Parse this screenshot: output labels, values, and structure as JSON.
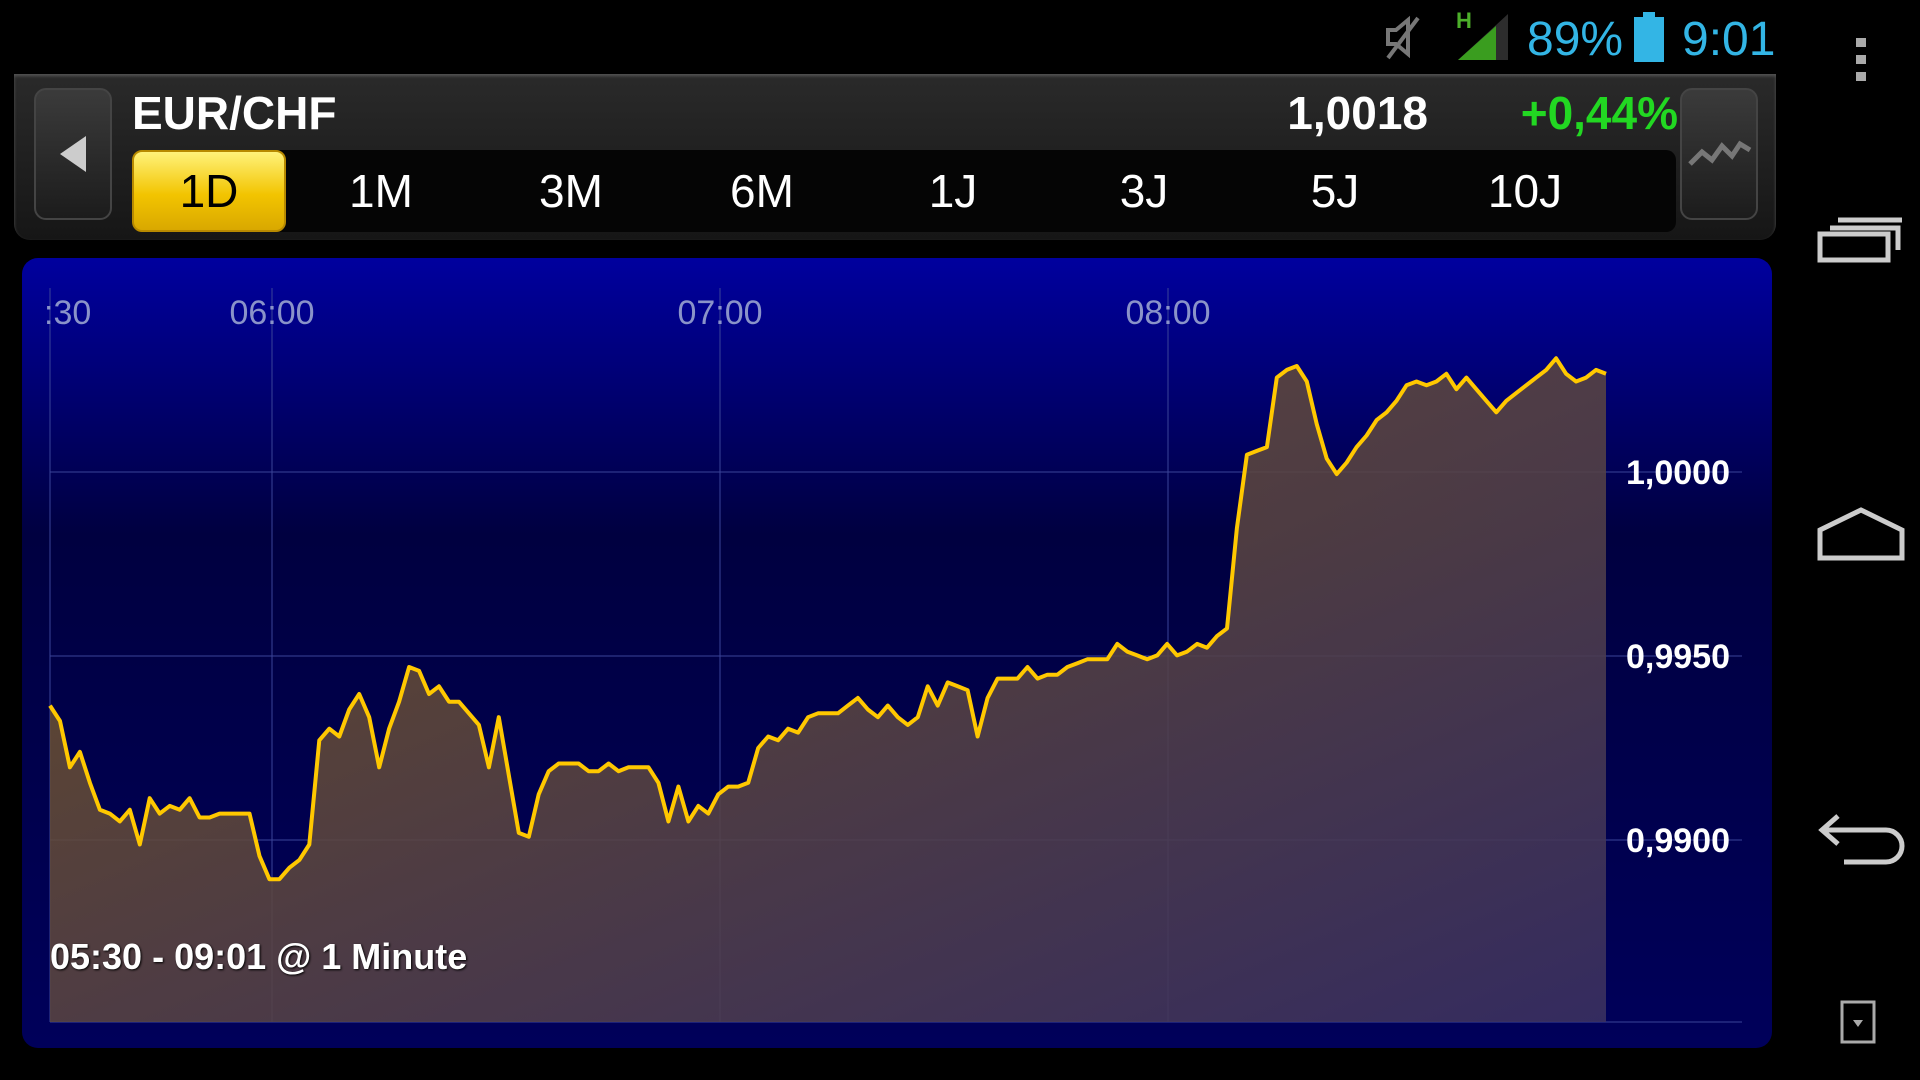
{
  "status_bar": {
    "battery_percent": "89%",
    "time": "9:01",
    "network_type": "H",
    "icons": [
      "mute-icon",
      "signal-icon",
      "battery-icon"
    ]
  },
  "header": {
    "pair": "EUR/CHF",
    "price": "1,0018",
    "change": "+0,44%",
    "tabs": [
      {
        "label": "1D",
        "active": true
      },
      {
        "label": "1M",
        "active": false
      },
      {
        "label": "3M",
        "active": false
      },
      {
        "label": "6M",
        "active": false
      },
      {
        "label": "1J",
        "active": false
      },
      {
        "label": "3J",
        "active": false
      },
      {
        "label": "5J",
        "active": false
      },
      {
        "label": "10J",
        "active": false
      }
    ]
  },
  "chart_data": {
    "type": "area",
    "x_ticks": [
      ":30",
      "06:00",
      "07:00",
      "08:00"
    ],
    "y_ticks": [
      "1,0000",
      "0,9950",
      "0,9900"
    ],
    "ylim": [
      0.9851,
      1.0049
    ],
    "caption": "05:30 - 09:01 @ 1 Minute",
    "line_color": "#ffc800",
    "series": [
      {
        "values": [
          0.9933,
          0.9929,
          0.9917,
          0.9921,
          0.9913,
          0.9906,
          0.9905,
          0.9903,
          0.9906,
          0.9897,
          0.9909,
          0.9905,
          0.9907,
          0.9906,
          0.9909,
          0.9904,
          0.9904,
          0.9905,
          0.9905,
          0.9905,
          0.9905,
          0.9894,
          0.9888,
          0.9888,
          0.9891,
          0.9893,
          0.9897,
          0.9924,
          0.9927,
          0.9925,
          0.9932,
          0.9936,
          0.993,
          0.9917,
          0.9927,
          0.9934,
          0.9943,
          0.9942,
          0.9936,
          0.9938,
          0.9934,
          0.9934,
          0.9931,
          0.9928,
          0.9917,
          0.993,
          0.9915,
          0.99,
          0.9899,
          0.991,
          0.9916,
          0.9918,
          0.9918,
          0.9918,
          0.9916,
          0.9916,
          0.9918,
          0.9916,
          0.9917,
          0.9917,
          0.9917,
          0.9913,
          0.9903,
          0.9912,
          0.9903,
          0.9907,
          0.9905,
          0.991,
          0.9912,
          0.9912,
          0.9913,
          0.9922,
          0.9925,
          0.9924,
          0.9927,
          0.9926,
          0.993,
          0.9931,
          0.9931,
          0.9931,
          0.9933,
          0.9935,
          0.9932,
          0.993,
          0.9933,
          0.993,
          0.9928,
          0.993,
          0.9938,
          0.9933,
          0.9939,
          0.9938,
          0.9937,
          0.9925,
          0.9935,
          0.994,
          0.994,
          0.994,
          0.9943,
          0.994,
          0.9941,
          0.9941,
          0.9943,
          0.9944,
          0.9945,
          0.9945,
          0.9945,
          0.9949,
          0.9947,
          0.9946,
          0.9945,
          0.9946,
          0.9949,
          0.9946,
          0.9947,
          0.9949,
          0.9948,
          0.9951,
          0.9953,
          0.9979,
          0.9998,
          0.9999,
          1.0,
          1.0018,
          1.002,
          1.0021,
          1.0017,
          1.0006,
          0.9997,
          0.9993,
          0.9996,
          1.0,
          1.0003,
          1.0007,
          1.0009,
          1.0012,
          1.0016,
          1.0017,
          1.0016,
          1.0017,
          1.0019,
          1.0015,
          1.0018,
          1.0015,
          1.0012,
          1.0009,
          1.0012,
          1.0014,
          1.0016,
          1.0018,
          1.002,
          1.0023,
          1.0019,
          1.0017,
          1.0018,
          1.002,
          1.0019
        ]
      }
    ]
  }
}
